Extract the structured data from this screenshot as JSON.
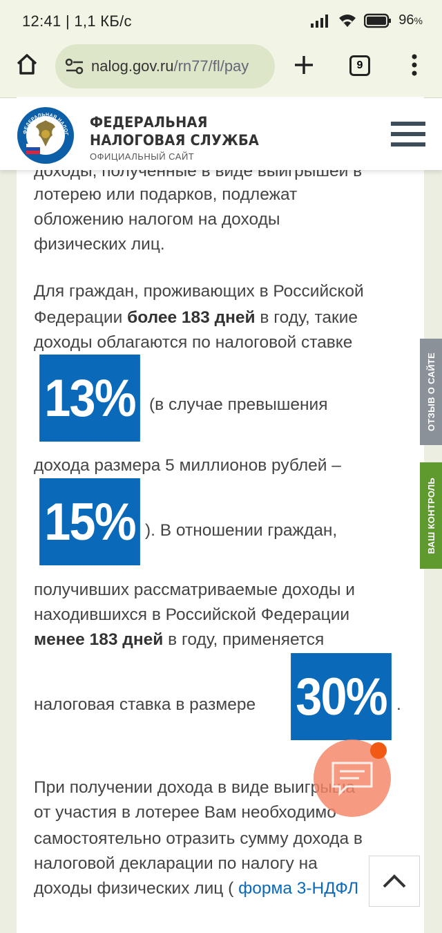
{
  "status_bar": {
    "time": "12:41 | 1,1 КБ/с",
    "battery": "96",
    "battery_unit": "%"
  },
  "browser": {
    "url_domain": "nalog.gov.ru",
    "url_path": "/rn77/fl/pay",
    "tab_count": "9"
  },
  "header": {
    "brand_line1": "ФЕДЕРАЛЬНАЯ",
    "brand_line2": "НАЛОГОВАЯ СЛУЖБА",
    "brand_sub": "ОФИЦИАЛЬНЫЙ САЙТ",
    "logo_ring_text": "ФЕДЕРАЛЬНАЯ НАЛОГОВАЯ СЛУЖБА"
  },
  "article": {
    "p1_line0": "доходы, полученные в виде выигрышей в",
    "p1_line1": "лотерею или подарков, подлежат",
    "p1_line2": "обложению налогом на доходы",
    "p1_line3": "физических лиц.",
    "p2_line1": "Для граждан, проживающих в Российской",
    "p2_line2_a": "Федерации ",
    "p2_line2_bold": "более 183 дней",
    "p2_line2_b": " в году, такие",
    "p2_line3": "доходы облагаются по налоговой ставке",
    "rate_13": "13%",
    "after_13": "(в случае превышения",
    "p2_line5": "дохода размера 5 миллионов рублей –",
    "rate_15": "15%",
    "after_15": "). В отношении граждан,",
    "p2_line7": "получивших рассматриваемые доходы и",
    "p2_line8": "находившихся в Российской Федерации",
    "p2_line9_bold": "менее 183 дней",
    "p2_line9_b": " в году, применяется",
    "p2_line10": "налоговая ставка в размере",
    "rate_30": "30%",
    "after_30": ".",
    "p3_line1": "При получении дохода в виде выигрыша",
    "p3_line2": "от участия в лотерее Вам необходимо",
    "p3_line3": "самостоятельно отразить сумму дохода в",
    "p3_line4": "налоговой декларации по налогу на",
    "p3_line5_a": "доходы физических лиц ( ",
    "p3_link": "форма 3-НДФЛ"
  },
  "side_tabs": {
    "feedback": "ОТЗЫВ О САЙТЕ",
    "control": "ВАШ КОНТРОЛЬ"
  },
  "colors": {
    "badge_blue": "#0a69b9",
    "feedback_tab": "#8a9199",
    "control_tab": "#5e9a2e",
    "chat_orange": "#f48567"
  }
}
